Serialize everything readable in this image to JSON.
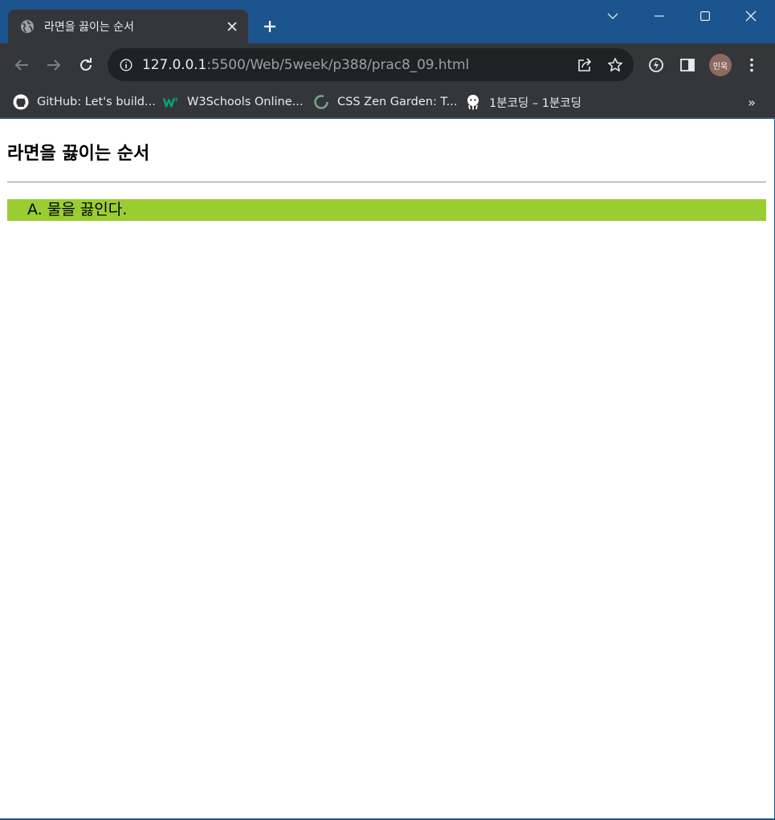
{
  "browser": {
    "tab": {
      "title": "라면을 끓이는 순서"
    },
    "address": {
      "host": "127.0.0.1",
      "path": ":5500/Web/5week/p388/prac8_09.html"
    },
    "profile": {
      "initials": "민욱"
    },
    "bookmarks": [
      {
        "label": "GitHub: Let's build...",
        "icon": "github-icon"
      },
      {
        "label": "W3Schools Online...",
        "icon": "w3schools-icon"
      },
      {
        "label": "CSS Zen Garden: T...",
        "icon": "zen-garden-icon"
      },
      {
        "label": "1분코딩 – 1분코딩",
        "icon": "onemin-coding-icon"
      }
    ],
    "bookmarks_overflow": "»"
  },
  "page": {
    "heading": "라면을 끓이는 순서",
    "steps": [
      {
        "marker": "A.",
        "text": "물을 끓인다."
      }
    ]
  },
  "colors": {
    "titlebar": "#1c5490",
    "toolbar": "#35363a",
    "omnibox": "#202124",
    "step_highlight": "#9acd32"
  }
}
